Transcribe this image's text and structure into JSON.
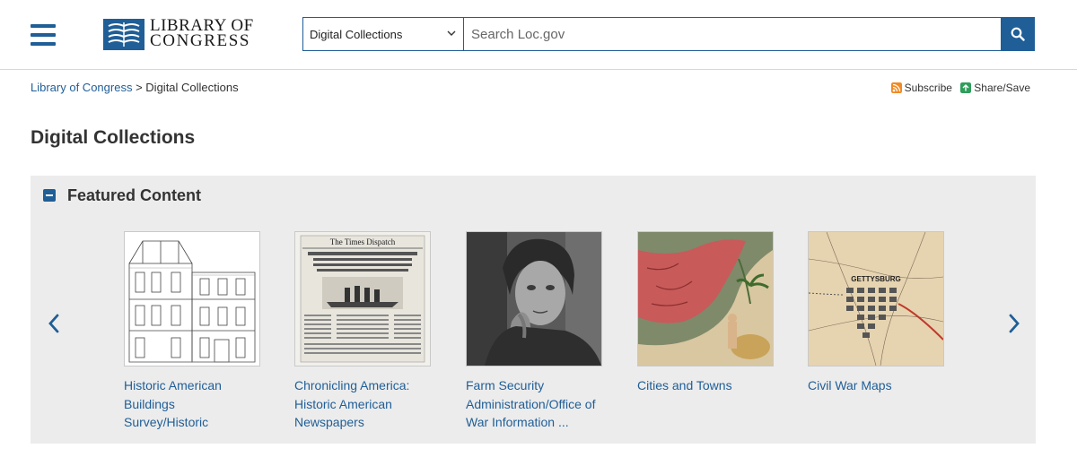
{
  "header": {
    "logo_line1": "LIBRARY OF",
    "logo_line2": "CONGRESS",
    "search_scope": "Digital Collections",
    "search_placeholder": "Search Loc.gov"
  },
  "breadcrumb": {
    "home": "Library of Congress",
    "separator": ">",
    "current": "Digital Collections"
  },
  "tools": {
    "subscribe": "Subscribe",
    "share": "Share/Save"
  },
  "page_title": "Digital Collections",
  "featured": {
    "title": "Featured Content",
    "items": [
      {
        "title": "Historic American Buildings Survey/Historic",
        "icon": "building-drawing"
      },
      {
        "title": "Chronicling America: Historic American Newspapers",
        "icon": "newspaper",
        "thumb_text": "The Times Dispatch"
      },
      {
        "title": "Farm Security Administration/Office of War Information ...",
        "icon": "portrait-photo"
      },
      {
        "title": "Cities and Towns",
        "icon": "colored-map"
      },
      {
        "title": "Civil War Maps",
        "icon": "town-map",
        "thumb_text": "GETTYSBURG"
      }
    ]
  },
  "colors": {
    "brand_blue": "#1f5e97",
    "panel_bg": "#ececec",
    "subscribe_orange": "#f08a24",
    "share_green": "#2e9e5b"
  }
}
